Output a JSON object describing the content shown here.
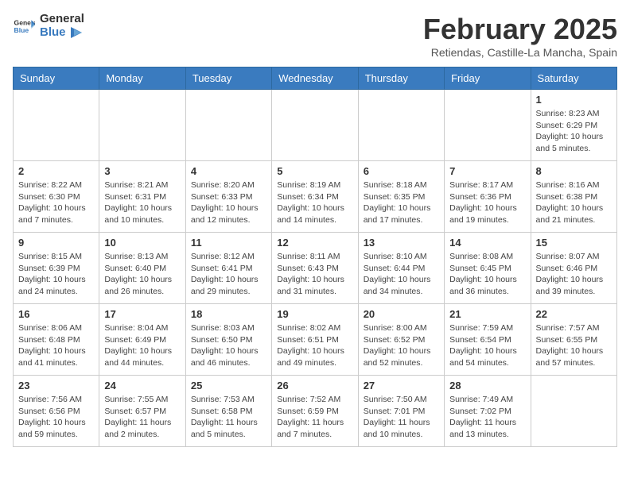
{
  "header": {
    "logo_general": "General",
    "logo_blue": "Blue",
    "title": "February 2025",
    "subtitle": "Retiendas, Castille-La Mancha, Spain"
  },
  "days_of_week": [
    "Sunday",
    "Monday",
    "Tuesday",
    "Wednesday",
    "Thursday",
    "Friday",
    "Saturday"
  ],
  "weeks": [
    {
      "days": [
        {
          "number": "",
          "info": ""
        },
        {
          "number": "",
          "info": ""
        },
        {
          "number": "",
          "info": ""
        },
        {
          "number": "",
          "info": ""
        },
        {
          "number": "",
          "info": ""
        },
        {
          "number": "",
          "info": ""
        },
        {
          "number": "1",
          "info": "Sunrise: 8:23 AM\nSunset: 6:29 PM\nDaylight: 10 hours\nand 5 minutes."
        }
      ]
    },
    {
      "days": [
        {
          "number": "2",
          "info": "Sunrise: 8:22 AM\nSunset: 6:30 PM\nDaylight: 10 hours\nand 7 minutes."
        },
        {
          "number": "3",
          "info": "Sunrise: 8:21 AM\nSunset: 6:31 PM\nDaylight: 10 hours\nand 10 minutes."
        },
        {
          "number": "4",
          "info": "Sunrise: 8:20 AM\nSunset: 6:33 PM\nDaylight: 10 hours\nand 12 minutes."
        },
        {
          "number": "5",
          "info": "Sunrise: 8:19 AM\nSunset: 6:34 PM\nDaylight: 10 hours\nand 14 minutes."
        },
        {
          "number": "6",
          "info": "Sunrise: 8:18 AM\nSunset: 6:35 PM\nDaylight: 10 hours\nand 17 minutes."
        },
        {
          "number": "7",
          "info": "Sunrise: 8:17 AM\nSunset: 6:36 PM\nDaylight: 10 hours\nand 19 minutes."
        },
        {
          "number": "8",
          "info": "Sunrise: 8:16 AM\nSunset: 6:38 PM\nDaylight: 10 hours\nand 21 minutes."
        }
      ]
    },
    {
      "days": [
        {
          "number": "9",
          "info": "Sunrise: 8:15 AM\nSunset: 6:39 PM\nDaylight: 10 hours\nand 24 minutes."
        },
        {
          "number": "10",
          "info": "Sunrise: 8:13 AM\nSunset: 6:40 PM\nDaylight: 10 hours\nand 26 minutes."
        },
        {
          "number": "11",
          "info": "Sunrise: 8:12 AM\nSunset: 6:41 PM\nDaylight: 10 hours\nand 29 minutes."
        },
        {
          "number": "12",
          "info": "Sunrise: 8:11 AM\nSunset: 6:43 PM\nDaylight: 10 hours\nand 31 minutes."
        },
        {
          "number": "13",
          "info": "Sunrise: 8:10 AM\nSunset: 6:44 PM\nDaylight: 10 hours\nand 34 minutes."
        },
        {
          "number": "14",
          "info": "Sunrise: 8:08 AM\nSunset: 6:45 PM\nDaylight: 10 hours\nand 36 minutes."
        },
        {
          "number": "15",
          "info": "Sunrise: 8:07 AM\nSunset: 6:46 PM\nDaylight: 10 hours\nand 39 minutes."
        }
      ]
    },
    {
      "days": [
        {
          "number": "16",
          "info": "Sunrise: 8:06 AM\nSunset: 6:48 PM\nDaylight: 10 hours\nand 41 minutes."
        },
        {
          "number": "17",
          "info": "Sunrise: 8:04 AM\nSunset: 6:49 PM\nDaylight: 10 hours\nand 44 minutes."
        },
        {
          "number": "18",
          "info": "Sunrise: 8:03 AM\nSunset: 6:50 PM\nDaylight: 10 hours\nand 46 minutes."
        },
        {
          "number": "19",
          "info": "Sunrise: 8:02 AM\nSunset: 6:51 PM\nDaylight: 10 hours\nand 49 minutes."
        },
        {
          "number": "20",
          "info": "Sunrise: 8:00 AM\nSunset: 6:52 PM\nDaylight: 10 hours\nand 52 minutes."
        },
        {
          "number": "21",
          "info": "Sunrise: 7:59 AM\nSunset: 6:54 PM\nDaylight: 10 hours\nand 54 minutes."
        },
        {
          "number": "22",
          "info": "Sunrise: 7:57 AM\nSunset: 6:55 PM\nDaylight: 10 hours\nand 57 minutes."
        }
      ]
    },
    {
      "days": [
        {
          "number": "23",
          "info": "Sunrise: 7:56 AM\nSunset: 6:56 PM\nDaylight: 10 hours\nand 59 minutes."
        },
        {
          "number": "24",
          "info": "Sunrise: 7:55 AM\nSunset: 6:57 PM\nDaylight: 11 hours\nand 2 minutes."
        },
        {
          "number": "25",
          "info": "Sunrise: 7:53 AM\nSunset: 6:58 PM\nDaylight: 11 hours\nand 5 minutes."
        },
        {
          "number": "26",
          "info": "Sunrise: 7:52 AM\nSunset: 6:59 PM\nDaylight: 11 hours\nand 7 minutes."
        },
        {
          "number": "27",
          "info": "Sunrise: 7:50 AM\nSunset: 7:01 PM\nDaylight: 11 hours\nand 10 minutes."
        },
        {
          "number": "28",
          "info": "Sunrise: 7:49 AM\nSunset: 7:02 PM\nDaylight: 11 hours\nand 13 minutes."
        },
        {
          "number": "",
          "info": ""
        }
      ]
    }
  ]
}
